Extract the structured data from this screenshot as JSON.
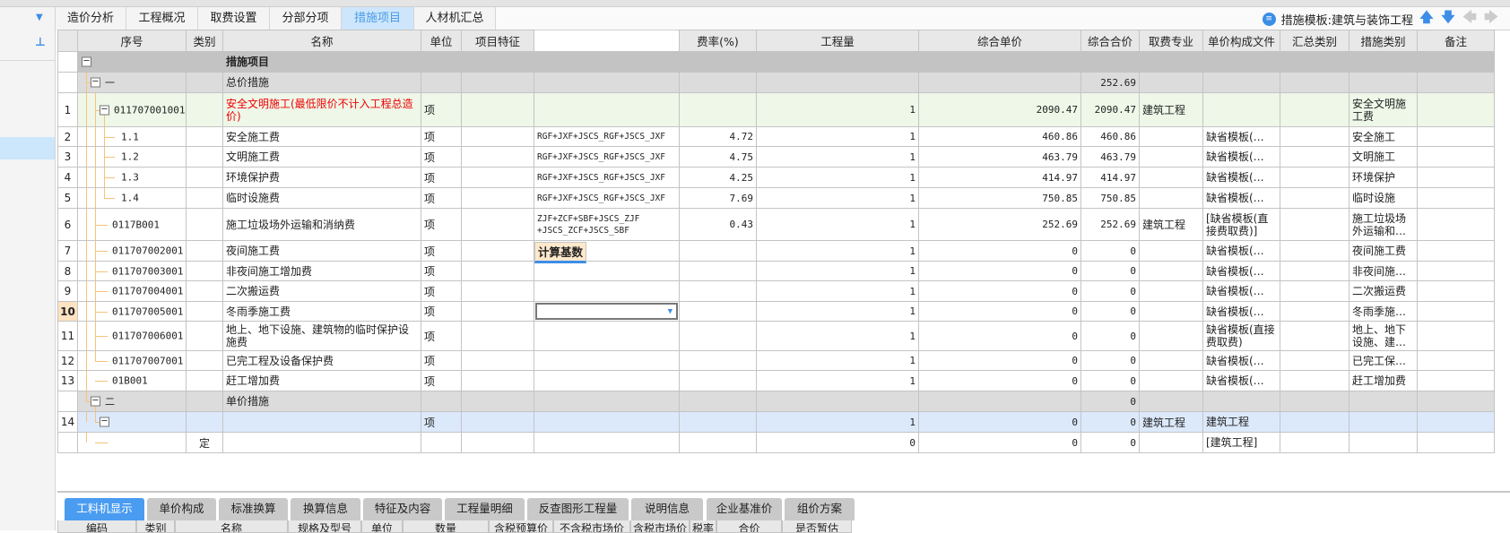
{
  "sidebar": {
    "dropdown_icon": "chevron-down-icon",
    "pin_icon": "pin-icon"
  },
  "tabs": [
    {
      "label": "造价分析",
      "active": false
    },
    {
      "label": "工程概况",
      "active": false
    },
    {
      "label": "取费设置",
      "active": false
    },
    {
      "label": "分部分项",
      "active": false
    },
    {
      "label": "措施项目",
      "active": true
    },
    {
      "label": "人材机汇总",
      "active": false
    }
  ],
  "template": {
    "label": "措施模板:建筑与装饰工程",
    "icon": "document-icon"
  },
  "toolbar": {
    "up_icon": "arrow-up-icon",
    "down_icon": "arrow-down-icon",
    "left_icon": "arrow-left-icon",
    "right_icon": "arrow-right-icon"
  },
  "colors": {
    "accent": "#3c8ee6",
    "tree_line": "#f7c27a",
    "root_row": "#c3c3c3",
    "group_row": "#dcdcdc",
    "highlight_row": "#eef7e8",
    "selected_row": "#dce9fb",
    "red_text": "#e00000"
  },
  "grid": {
    "columns": [
      "",
      "序号",
      "类别",
      "名称",
      "单位",
      "项目特征",
      "计算基数",
      "费率(%)",
      "工程量",
      "综合单价",
      "综合合价",
      "取费专业",
      "单价构成文件",
      "汇总类别",
      "措施类别",
      "备注"
    ],
    "rows": [
      {
        "num": "",
        "seq": "",
        "type": "",
        "name": "措施项目",
        "unit": "",
        "feature": "",
        "base": "",
        "rate": "",
        "qty": "",
        "price": "",
        "total": "",
        "major": "",
        "file": "",
        "sum": "",
        "mcat": "",
        "note": "",
        "level": 0,
        "kind": "root"
      },
      {
        "num": "",
        "seq": "一",
        "type": "",
        "name": "总价措施",
        "unit": "",
        "feature": "",
        "base": "",
        "rate": "",
        "qty": "",
        "price": "",
        "total": "252.69",
        "major": "",
        "file": "",
        "sum": "",
        "mcat": "",
        "note": "",
        "level": 1,
        "kind": "group"
      },
      {
        "num": "1",
        "seq": "011707001001",
        "type": "",
        "name": "安全文明施工(最低限价不计入工程总造价)",
        "unit": "项",
        "feature": "",
        "base": "",
        "rate": "",
        "qty": "1",
        "price": "2090.47",
        "total": "2090.47",
        "major": "建筑工程",
        "file": "",
        "sum": "",
        "mcat": "安全文明施工费",
        "note": "",
        "level": 2,
        "kind": "hl"
      },
      {
        "num": "2",
        "seq": "1.1",
        "type": "",
        "name": "安全施工费",
        "unit": "项",
        "feature": "",
        "base": "RGF+JXF+JSCS_RGF+JSCS_JXF",
        "rate": "4.72",
        "qty": "1",
        "price": "460.86",
        "total": "460.86",
        "major": "",
        "file": "缺省模板(…",
        "sum": "",
        "mcat": "安全施工",
        "note": "",
        "level": 3,
        "kind": "item"
      },
      {
        "num": "3",
        "seq": "1.2",
        "type": "",
        "name": "文明施工费",
        "unit": "项",
        "feature": "",
        "base": "RGF+JXF+JSCS_RGF+JSCS_JXF",
        "rate": "4.75",
        "qty": "1",
        "price": "463.79",
        "total": "463.79",
        "major": "",
        "file": "缺省模板(…",
        "sum": "",
        "mcat": "文明施工",
        "note": "",
        "level": 3,
        "kind": "item"
      },
      {
        "num": "4",
        "seq": "1.3",
        "type": "",
        "name": "环境保护费",
        "unit": "项",
        "feature": "",
        "base": "RGF+JXF+JSCS_RGF+JSCS_JXF",
        "rate": "4.25",
        "qty": "1",
        "price": "414.97",
        "total": "414.97",
        "major": "",
        "file": "缺省模板(…",
        "sum": "",
        "mcat": "环境保护",
        "note": "",
        "level": 3,
        "kind": "item"
      },
      {
        "num": "5",
        "seq": "1.4",
        "type": "",
        "name": "临时设施费",
        "unit": "项",
        "feature": "",
        "base": "RGF+JXF+JSCS_RGF+JSCS_JXF",
        "rate": "7.69",
        "qty": "1",
        "price": "750.85",
        "total": "750.85",
        "major": "",
        "file": "缺省模板(…",
        "sum": "",
        "mcat": "临时设施",
        "note": "",
        "level": 3,
        "kind": "item"
      },
      {
        "num": "6",
        "seq": "0117B001",
        "type": "",
        "name": "施工垃圾场外运输和消纳费",
        "unit": "项",
        "feature": "",
        "base": "ZJF+ZCF+SBF+JSCS_ZJF +JSCS_ZCF+JSCS_SBF",
        "rate": "0.43",
        "qty": "1",
        "price": "252.69",
        "total": "252.69",
        "major": "建筑工程",
        "file": "[缺省模板(直接费取费)]",
        "sum": "",
        "mcat": "施工垃圾场外运输和…",
        "note": "",
        "level": 2,
        "kind": "item"
      },
      {
        "num": "7",
        "seq": "011707002001",
        "type": "",
        "name": "夜间施工费",
        "unit": "项",
        "feature": "",
        "base": "",
        "rate": "",
        "qty": "1",
        "price": "0",
        "total": "0",
        "major": "",
        "file": "缺省模板(…",
        "sum": "",
        "mcat": "夜间施工费",
        "note": "",
        "level": 2,
        "kind": "item"
      },
      {
        "num": "8",
        "seq": "011707003001",
        "type": "",
        "name": "非夜间施工增加费",
        "unit": "项",
        "feature": "",
        "base": "",
        "rate": "",
        "qty": "1",
        "price": "0",
        "total": "0",
        "major": "",
        "file": "缺省模板(…",
        "sum": "",
        "mcat": "非夜间施…",
        "note": "",
        "level": 2,
        "kind": "item"
      },
      {
        "num": "9",
        "seq": "011707004001",
        "type": "",
        "name": "二次搬运费",
        "unit": "项",
        "feature": "",
        "base": "",
        "rate": "",
        "qty": "1",
        "price": "0",
        "total": "0",
        "major": "",
        "file": "缺省模板(…",
        "sum": "",
        "mcat": "二次搬运费",
        "note": "",
        "level": 2,
        "kind": "item"
      },
      {
        "num": "10",
        "seq": "011707005001",
        "type": "",
        "name": "冬雨季施工费",
        "unit": "项",
        "feature": "",
        "base": "",
        "rate": "",
        "qty": "1",
        "price": "0",
        "total": "0",
        "major": "",
        "file": "缺省模板(…",
        "sum": "",
        "mcat": "冬雨季施…",
        "note": "",
        "level": 2,
        "kind": "cur"
      },
      {
        "num": "11",
        "seq": "011707006001",
        "type": "",
        "name": "地上、地下设施、建筑物的临时保护设施费",
        "unit": "项",
        "feature": "",
        "base": "",
        "rate": "",
        "qty": "1",
        "price": "0",
        "total": "0",
        "major": "",
        "file": "缺省模板(直接费取费)",
        "sum": "",
        "mcat": "地上、地下设施、建…",
        "note": "",
        "level": 2,
        "kind": "item"
      },
      {
        "num": "12",
        "seq": "011707007001",
        "type": "",
        "name": "已完工程及设备保护费",
        "unit": "项",
        "feature": "",
        "base": "",
        "rate": "",
        "qty": "1",
        "price": "0",
        "total": "0",
        "major": "",
        "file": "缺省模板(…",
        "sum": "",
        "mcat": "已完工保…",
        "note": "",
        "level": 2,
        "kind": "item"
      },
      {
        "num": "13",
        "seq": "01B001",
        "type": "",
        "name": "赶工增加费",
        "unit": "项",
        "feature": "",
        "base": "",
        "rate": "",
        "qty": "1",
        "price": "0",
        "total": "0",
        "major": "",
        "file": "缺省模板(…",
        "sum": "",
        "mcat": "赶工增加费",
        "note": "",
        "level": 2,
        "kind": "item"
      },
      {
        "num": "",
        "seq": "二",
        "type": "",
        "name": "单价措施",
        "unit": "",
        "feature": "",
        "base": "",
        "rate": "",
        "qty": "",
        "price": "",
        "total": "0",
        "major": "",
        "file": "",
        "sum": "",
        "mcat": "",
        "note": "",
        "level": 1,
        "kind": "group"
      },
      {
        "num": "14",
        "seq": "",
        "type": "",
        "name": "",
        "unit": "项",
        "feature": "",
        "base": "",
        "rate": "",
        "qty": "1",
        "price": "0",
        "total": "0",
        "major": "建筑工程",
        "file": "建筑工程",
        "sum": "",
        "mcat": "",
        "note": "",
        "level": 2,
        "kind": "sel"
      },
      {
        "num": "",
        "seq": "",
        "type": "定",
        "name": "",
        "unit": "",
        "feature": "",
        "base": "",
        "rate": "",
        "qty": "0",
        "price": "0",
        "total": "0",
        "major": "",
        "file": "[建筑工程]",
        "sum": "",
        "mcat": "",
        "note": "",
        "level": 3,
        "kind": "detail"
      }
    ]
  },
  "bottom_tabs": [
    {
      "label": "工料机显示",
      "active": true
    },
    {
      "label": "单价构成",
      "active": false
    },
    {
      "label": "标准换算",
      "active": false
    },
    {
      "label": "换算信息",
      "active": false
    },
    {
      "label": "特征及内容",
      "active": false
    },
    {
      "label": "工程量明细",
      "active": false
    },
    {
      "label": "反查图形工程量",
      "active": false
    },
    {
      "label": "说明信息",
      "active": false
    },
    {
      "label": "企业基准价",
      "active": false
    },
    {
      "label": "组价方案",
      "active": false
    }
  ],
  "bottom_columns": [
    "编码",
    "类别",
    "名称",
    "规格及型号",
    "单位",
    "数量",
    "含税预算价",
    "不含税市场价",
    "含税市场价",
    "税率",
    "合价",
    "是否暂估"
  ]
}
